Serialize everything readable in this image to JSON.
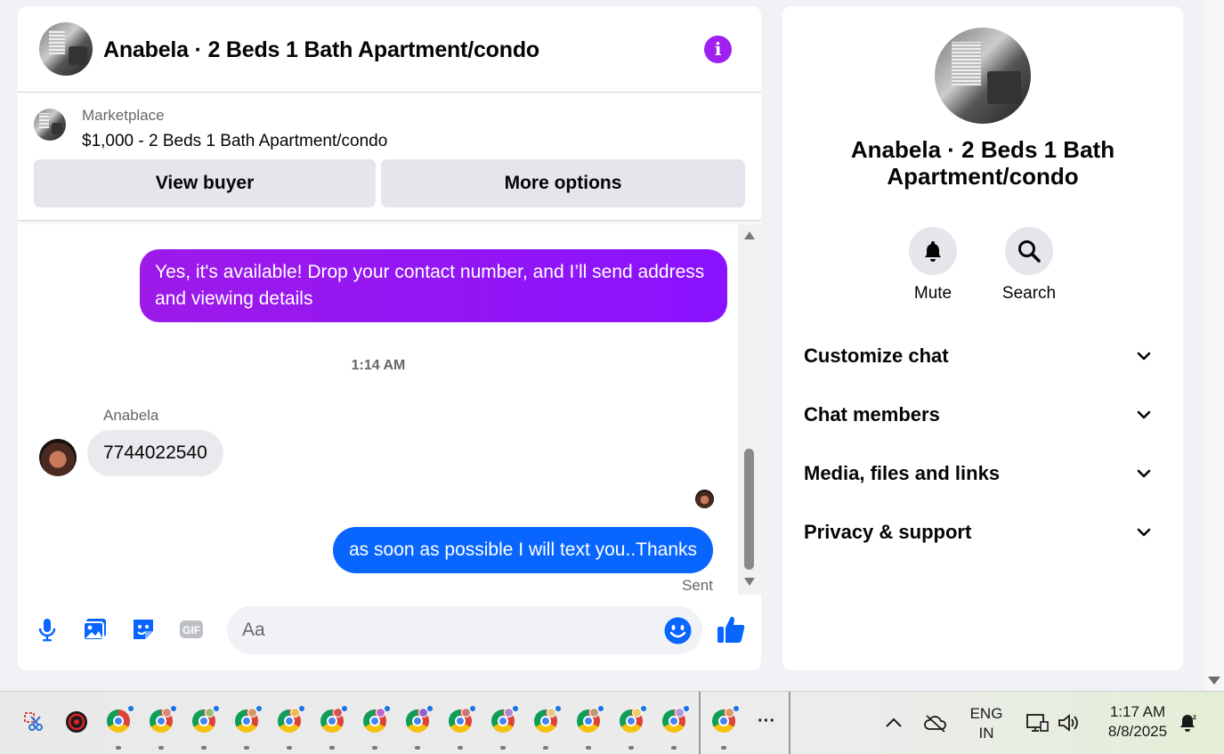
{
  "chat": {
    "title": "Anabela · 2 Beds 1 Bath Apartment/condo",
    "info_icon": "info-icon",
    "marketplace": {
      "label": "Marketplace",
      "listing": "$1,000 - 2 Beds 1 Bath Apartment/condo",
      "view_buyer": "View buyer",
      "more_options": "More options"
    },
    "messages": {
      "outgoing_1": "Yes, it's available! Drop your contact number, and I’ll send address and viewing details",
      "timestamp": "1:14 AM",
      "sender_name": "Anabela",
      "incoming_1": "7744022540",
      "outgoing_2": "as soon as possible I will text you..Thanks",
      "status": "Sent"
    },
    "composer": {
      "placeholder": "Aa"
    },
    "colors": {
      "accent_purple": "#8a12ff",
      "messenger_blue": "#0866ff",
      "bubble_gray": "#e9eaed"
    }
  },
  "info_panel": {
    "title": "Anabela · 2 Beds 1 Bath Apartment/condo",
    "actions": {
      "mute": "Mute",
      "search": "Search"
    },
    "sections": [
      "Customize chat",
      "Chat members",
      "Media, files and links",
      "Privacy & support"
    ]
  },
  "taskbar": {
    "language_top": "ENG",
    "language_bottom": "IN",
    "time": "1:17 AM",
    "date": "8/8/2025",
    "more": "···"
  }
}
